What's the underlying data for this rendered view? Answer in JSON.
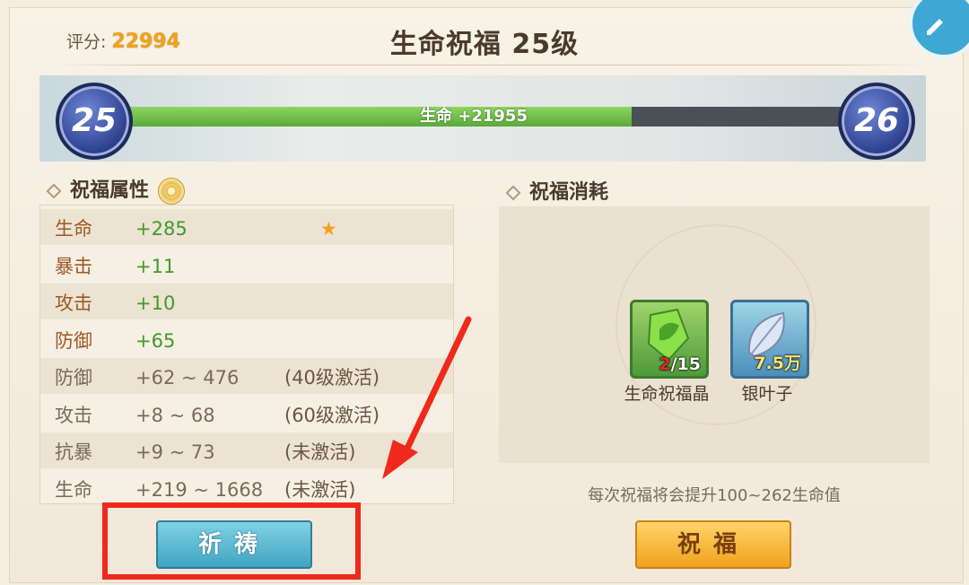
{
  "header": {
    "score_label": "评分:",
    "score_value": "22994",
    "title": "生命祝福 25级"
  },
  "progress": {
    "current_level": "25",
    "next_level": "26",
    "label": "生命 +21955",
    "fill_fraction": 0.71,
    "fill_color": "#6cbf47"
  },
  "attributes": {
    "heading": "祝福属性",
    "rows": [
      {
        "name": "生命",
        "value": "+285",
        "note": "",
        "starred": true,
        "active": true
      },
      {
        "name": "暴击",
        "value": "+11",
        "note": "",
        "active": true
      },
      {
        "name": "攻击",
        "value": "+10",
        "note": "",
        "active": true
      },
      {
        "name": "防御",
        "value": "+65",
        "note": "",
        "active": true
      },
      {
        "name": "防御",
        "value": "+62 ~ 476",
        "note": "(40级激活)",
        "active": false
      },
      {
        "name": "攻击",
        "value": "+8 ~ 68",
        "note": "(60级激活)",
        "active": false
      },
      {
        "name": "抗暴",
        "value": "+9 ~ 73",
        "note": "(未激活)",
        "active": false
      },
      {
        "name": "生命",
        "value": "+219 ~ 1668",
        "note": "(未激活)",
        "active": false
      }
    ]
  },
  "cost": {
    "heading": "祝福消耗",
    "items": [
      {
        "name": "生命祝福晶",
        "have": "2",
        "need": "/15",
        "icon": "green-crystal-icon"
      },
      {
        "name": "银叶子",
        "amount": "7.5万",
        "icon": "silver-leaf-icon"
      }
    ],
    "hint": "每次祝福将会提升100~262生命值"
  },
  "buttons": {
    "pray": "祈祷",
    "bless": "祝福"
  },
  "colors": {
    "accent_gold": "#f0a21c",
    "green": "#3f9a2a",
    "annotation_red": "#ef2a1c"
  }
}
